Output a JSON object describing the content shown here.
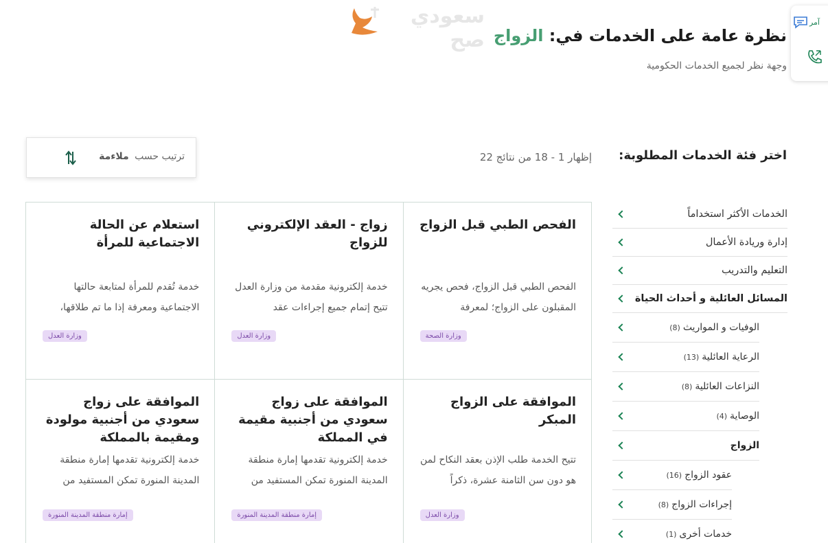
{
  "header": {
    "title_prefix": "نظرة عامة على الخدمات في: ",
    "title_accent": "الزواج",
    "subtitle": "وجهة نظر لجميع الخدمات الحكومية",
    "logo_text": "سعودي صح"
  },
  "float_widget": {
    "chat_label": "آمر",
    "chat_icon": "chat-icon",
    "call_icon": "phone-icon"
  },
  "toolbar": {
    "category_heading": "اختر فئة الخدمات المطلوبة:",
    "results_count": "إظهار 1 - 18 من نتائج 22",
    "sort_label": "ترتيب حسب",
    "sort_value": "ملاءمة",
    "sort_icon": "sort-arrows-icon"
  },
  "sidebar": {
    "items": [
      {
        "label": "الخدمات الأكثر استخداماً",
        "count": "",
        "level": "top",
        "bold": false
      },
      {
        "label": "إدارة وريادة الأعمال",
        "count": "",
        "level": "top",
        "bold": false
      },
      {
        "label": "التعليم والتدريب",
        "count": "",
        "level": "top",
        "bold": false
      },
      {
        "label": "المسائل العائلية و أحداث الحياة",
        "count": "",
        "level": "top",
        "bold": true
      },
      {
        "label": "الوفيات و المواريث",
        "count": "(8)",
        "level": "sub",
        "bold": false
      },
      {
        "label": "الرعاية العائلية",
        "count": "(13)",
        "level": "sub",
        "bold": false
      },
      {
        "label": "النزاعات العائلية",
        "count": "(8)",
        "level": "sub",
        "bold": false
      },
      {
        "label": "الوصاية",
        "count": "(4)",
        "level": "sub",
        "bold": false
      },
      {
        "label": "الزواج",
        "count": "",
        "level": "sub",
        "bold": true
      },
      {
        "label": "عقود الزواج",
        "count": "(16)",
        "level": "subsub",
        "bold": false
      },
      {
        "label": "إجراءات الزواج",
        "count": "(8)",
        "level": "subsub",
        "bold": false
      },
      {
        "label": "خدمات أخرى",
        "count": "(1)",
        "level": "subsub",
        "bold": false
      }
    ]
  },
  "cards": [
    {
      "title": "الفحص الطبي قبل الزواج",
      "desc": "الفحص الطبي قبل الزواج، فحص يجريه المقبلون على الزواج؛ لمعرفة",
      "badge": "وزارة الصحة"
    },
    {
      "title": "زواج - العقد الإلكتروني للزواج",
      "desc": "خدمة إلكترونية مقدمة من وزارة العدل تتيح إتمام جميع إجراءات عقد",
      "badge": "وزارة العدل"
    },
    {
      "title": "استعلام عن الحالة الاجتماعية للمرأة",
      "desc": "خدمة تُقدم للمرأة لمتابعة حالتها الاجتماعية ومعرفة إذا ما تم طلاقها،",
      "badge": "وزارة العدل"
    },
    {
      "title": "الموافقة على الزواج المبكر",
      "desc": "تتيح الخدمة طلب الإذن بعقد النكاح لمن هو دون سن الثامنة عشرة، ذكراً",
      "badge": "وزارة العدل"
    },
    {
      "title": "الموافقة على زواج سعودي من أجنبية مقيمة في المملكة",
      "desc": "خدمة إلكترونية تقدمها إمارة منطقة المدينة المنورة تمكن المستفيد من",
      "badge": "إمارة منطقة المدينة المنورة"
    },
    {
      "title": "الموافقة على زواج سعودي من أجنبية مولودة ومقيمة بالمملكة",
      "desc": "خدمة إلكترونية تقدمها إمارة منطقة المدينة المنورة تمكن المستفيد من",
      "badge": "إمارة منطقة المدينة المنورة"
    }
  ],
  "colors": {
    "accent": "#479e72",
    "chevron": "#1b8354",
    "badge_bg": "#e8d9f6",
    "badge_text": "#7c4aa8"
  }
}
